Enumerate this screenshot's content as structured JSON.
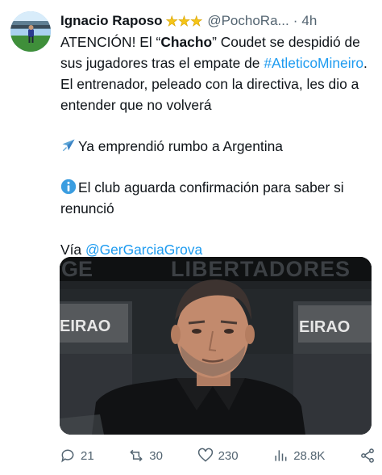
{
  "user": {
    "display_name": "Ignacio Raposo",
    "badge_stars": "⭐⭐⭐",
    "handle": "@PochoRa...",
    "separator": "·",
    "time": "4h"
  },
  "tweet": {
    "p1_a": "ATENCIÓN! El “",
    "p1_bold": "Chacho",
    "p1_b": "” Coudet se despidió de sus jugadores tras el empate de ",
    "p1_hashtag": "#AtleticoMineiro",
    "p1_c": ". El entrenador, peleado con la directiva, les dio a entender que no volverá",
    "p2": "Ya emprendió rumbo a Argentina",
    "p3": "El club aguarda confirmación para saber si renunció",
    "p4_prefix": "Vía ",
    "p4_mention": "@GerGarciaGrova"
  },
  "media": {
    "banner_text": "LIBERTADORES",
    "board_left": "EIRAO",
    "board_right": "EIRAO"
  },
  "actions": {
    "replies": "21",
    "retweets": "30",
    "likes": "230",
    "views": "28.8K"
  },
  "icons": {
    "p2_emoji": "airplane-icon",
    "p3_emoji": "info-icon"
  },
  "colors": {
    "link": "#1d9bf0",
    "secondary": "#536471",
    "star": "#f5c518"
  }
}
